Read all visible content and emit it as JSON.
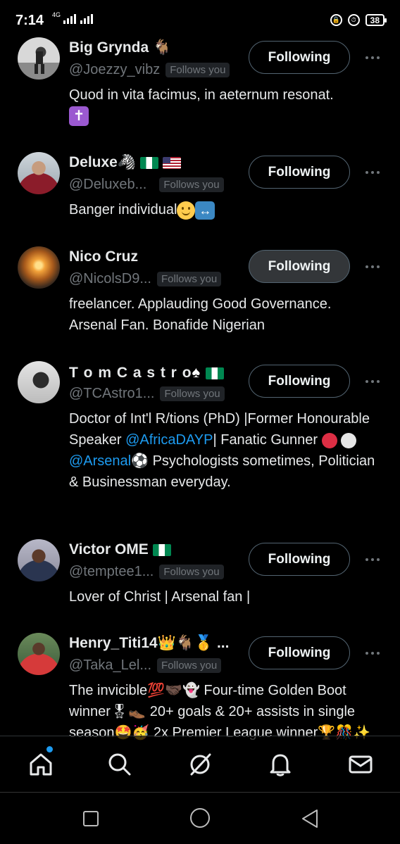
{
  "status_bar": {
    "time": "7:14",
    "network": "4G",
    "battery": "38"
  },
  "users": [
    {
      "name": "Big Grynda 🐐",
      "handle": "@Joezzy_vibz",
      "follows_you": "Follows you",
      "button": "Following",
      "bio": "Quod in vita facimus, in aeternum resonat.",
      "bio_emoji": "✝"
    },
    {
      "name": "Deluxe🦓",
      "handle": "@Deluxeb...",
      "follows_you": "Follows you",
      "button": "Following",
      "bio": "Banger individual"
    },
    {
      "name": "Nico Cruz",
      "handle": "@NicolsD9...",
      "follows_you": "Follows you",
      "button": "Following",
      "bio": "freelancer. Applauding Good Governance. Arsenal Fan. Bonafide Nigerian"
    },
    {
      "name": "T o m C a s t r o",
      "handle": "@TCAstro1...",
      "follows_you": "Follows you",
      "button": "Following",
      "bio_part1": "Doctor of Int'l R/tions (PhD) |Former Honourable Speaker ",
      "bio_link1": "@AfricaDAYP",
      "bio_part2": "| Fanatic Gunner ",
      "bio_link2": "@Arsenal",
      "bio_part3": "⚽ Psychologists sometimes, Politician & Businessman everyday."
    },
    {
      "name": "Victor OME",
      "handle": "@temptee1...",
      "follows_you": "Follows you",
      "button": "Following",
      "bio": "Lover of Christ | Arsenal fan |"
    },
    {
      "name": "Henry_Titi14👑🐐🥇 ...",
      "handle": "@Taka_Lel...",
      "follows_you": "Follows you",
      "button": "Following",
      "bio": "The invicible💯🤝🏿👻 Four-time Golden Boot winner🎖👞 20+ goals & 20+ assists in single season🤩🥳 2x Premier League winner🏆🎊✨"
    }
  ],
  "nav": {
    "home": "home-icon",
    "search": "search-icon",
    "grok": "grok-icon",
    "notifications": "bell-icon",
    "messages": "mail-icon"
  },
  "colors": {
    "background": "#000000",
    "text": "#e7e9ea",
    "secondary": "#71767b",
    "link": "#1d9bf0"
  }
}
